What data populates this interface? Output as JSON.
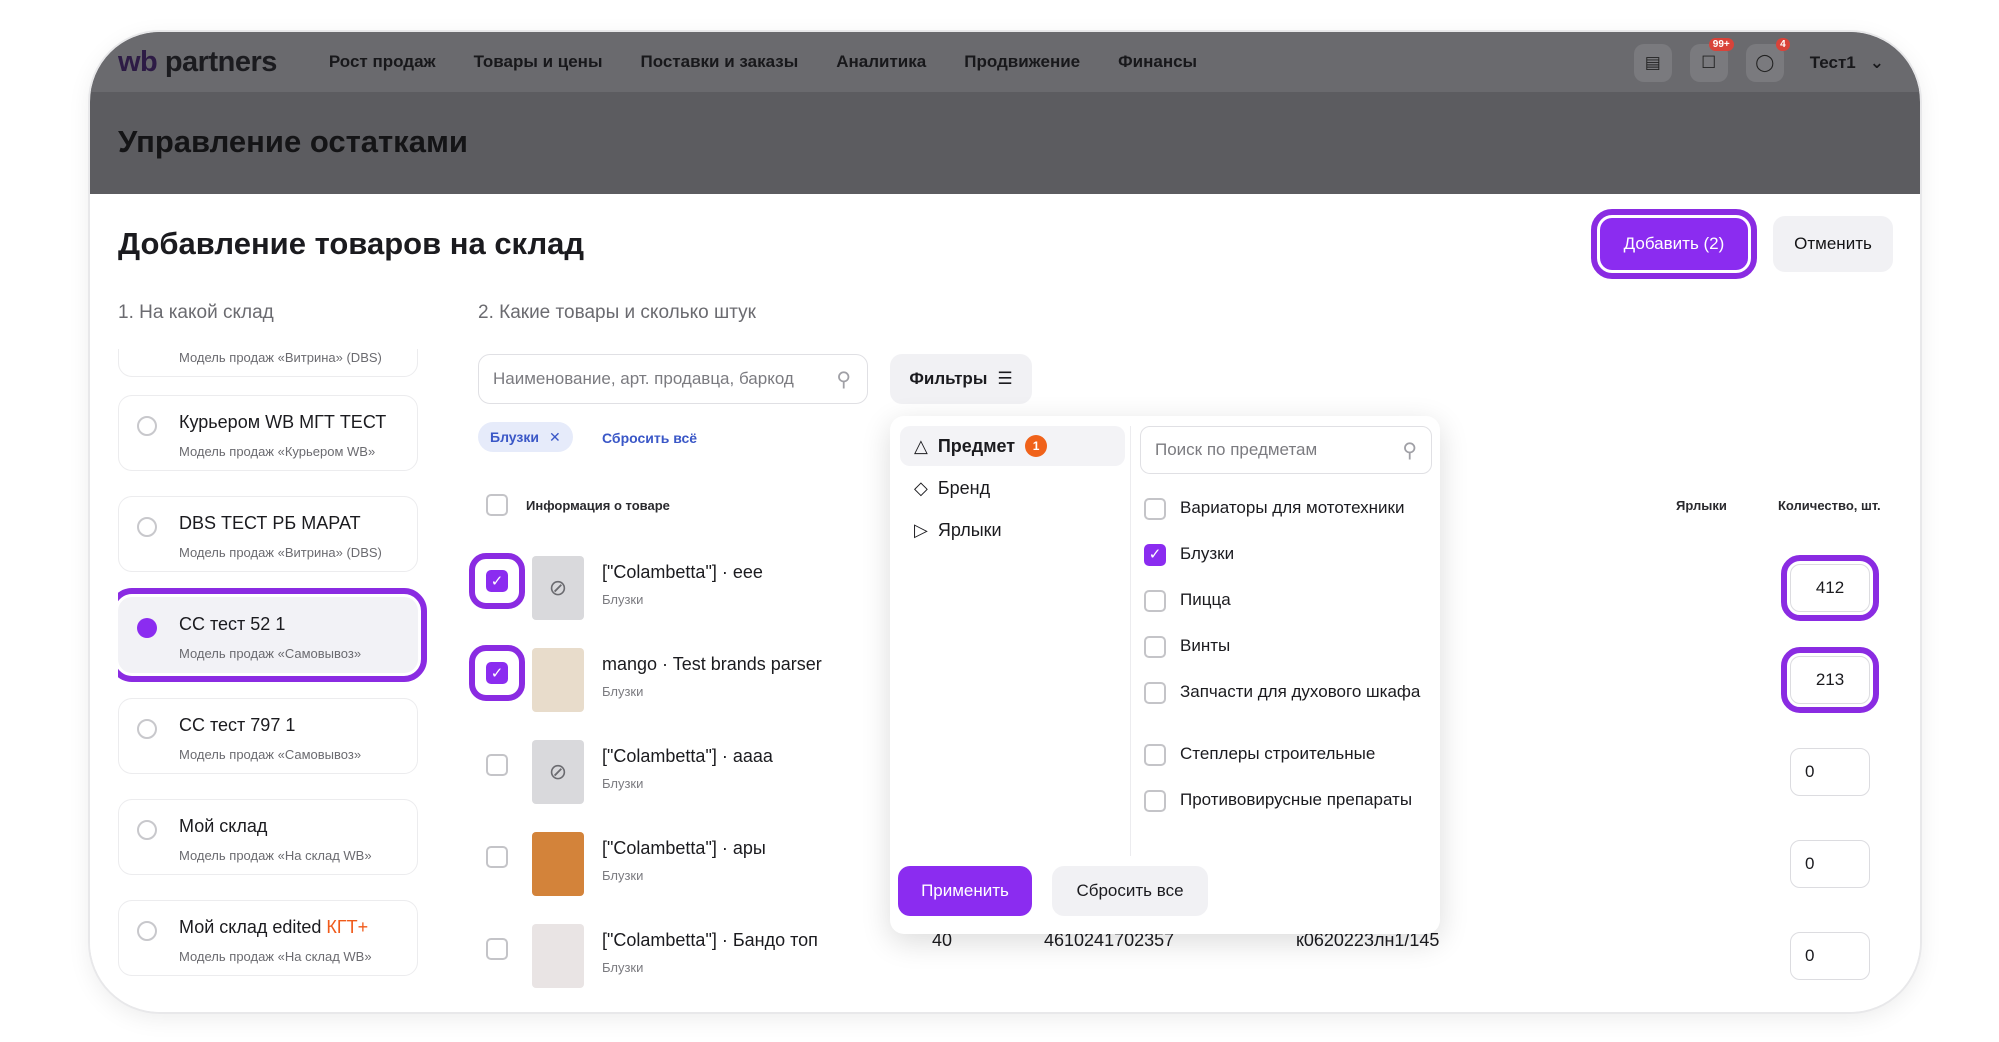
{
  "nav": {
    "logo_wb": "wb",
    "logo_rest": " partners",
    "links": [
      "Рост продаж",
      "Товары и цены",
      "Поставки и заказы",
      "Аналитика",
      "Продвижение",
      "Финансы"
    ],
    "icons": {
      "chat": "chat-icon",
      "bell_badge": "99+",
      "support_badge": "4"
    },
    "user": "Тест1"
  },
  "page_title": "Управление остатками",
  "dialog": {
    "title": "Добавление товаров на склад",
    "add_button": "Добавить (2)",
    "cancel_button": "Отменить",
    "step1": "1. На какой склад",
    "step2": "2. Какие товары и сколько штук"
  },
  "warehouses": [
    {
      "name": "",
      "desc": "Модель продаж «Витрина» (DBS)",
      "selected": false
    },
    {
      "name": "Курьером WB МГТ ТЕСТ",
      "desc": "Модель продаж «Курьером WB»",
      "selected": false
    },
    {
      "name": "DBS ТЕСТ РБ МАРАТ",
      "desc": "Модель продаж «Витрина» (DBS)",
      "selected": false
    },
    {
      "name": "СС тест 52 1",
      "desc": "Модель продаж «Самовывоз»",
      "selected": true
    },
    {
      "name": "СС тест 797 1",
      "desc": "Модель продаж «Самовывоз»",
      "selected": false
    },
    {
      "name": "Мой склад",
      "desc": "Модель продаж «На склад WB»",
      "selected": false
    },
    {
      "name": "Мой склад edited ",
      "tag": "КГТ+",
      "desc": "Модель продаж «На склад WB»",
      "selected": false
    }
  ],
  "search": {
    "placeholder": "Наименование, арт. продавца, баркод"
  },
  "filters_button": "Фильтры",
  "active_chip": "Блузки",
  "reset_all_link": "Сбросить всё",
  "table": {
    "headers": {
      "info": "Информация о товаре",
      "labels": "Ярлыки",
      "qty": "Количество, шт."
    },
    "rows": [
      {
        "title": "[\"Colambetta\"] · eee",
        "subject": "Блузки",
        "checked": true,
        "qty": "412",
        "col1": "",
        "col2": "",
        "col3": ""
      },
      {
        "title": "mango · Test brands parser",
        "subject": "Блузки",
        "checked": true,
        "qty": "213",
        "col1": "",
        "col2": "",
        "col3": ""
      },
      {
        "title": "[\"Colambetta\"] · аааа",
        "subject": "Блузки",
        "checked": false,
        "qty": "0",
        "col1": "",
        "col2": "",
        "col3": ""
      },
      {
        "title": "[\"Colambetta\"] · ары",
        "subject": "Блузки",
        "checked": false,
        "qty": "0",
        "col1": "",
        "col2": "",
        "col3": ""
      },
      {
        "title": "[\"Colambetta\"] · Бандо топ",
        "subject": "Блузки",
        "checked": false,
        "qty": "0",
        "col1": "40",
        "col2": "4610241702357",
        "col3": "к0620223лн1/145"
      }
    ]
  },
  "filter_dropdown": {
    "categories": [
      {
        "label": "Предмет",
        "count": "1",
        "icon": "shapes-icon",
        "active": true
      },
      {
        "label": "Бренд",
        "count": "",
        "icon": "tag-icon",
        "active": false
      },
      {
        "label": "Ярлыки",
        "count": "",
        "icon": "label-icon",
        "active": false
      }
    ],
    "search_placeholder": "Поиск по предметам",
    "options": [
      {
        "label": "Вариаторы для мототехники",
        "checked": false
      },
      {
        "label": "Блузки",
        "checked": true
      },
      {
        "label": "Пицца",
        "checked": false
      },
      {
        "label": "Винты",
        "checked": false
      },
      {
        "label": "Запчасти для духового шкафа",
        "checked": false
      },
      {
        "label": "Степлеры строительные",
        "checked": false
      },
      {
        "label": "Противовирусные препараты",
        "checked": false
      }
    ],
    "apply_button": "Применить",
    "reset_button": "Сбросить все"
  },
  "colors": {
    "accent": "#8b2cf0",
    "highlight": "#8a2be2",
    "link": "#3a57c7",
    "tag": "#f05a1a"
  }
}
